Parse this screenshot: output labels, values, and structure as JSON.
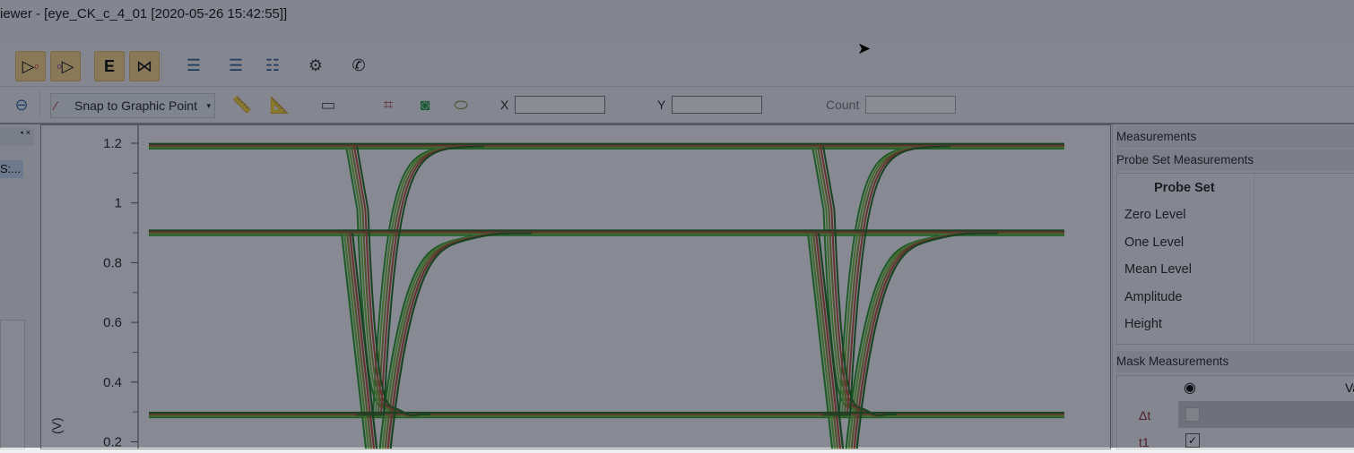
{
  "window": {
    "title": "iewer - [eye_CK_c_4_01  [2020-05-26 15:42:55]]"
  },
  "toolbar1": {
    "icons": [
      "gate-inverter-out-icon",
      "gate-inverter-in-icon",
      "edge-icon",
      "mux-icon",
      "layout-1-icon",
      "layout-2-icon",
      "layout-3-icon",
      "gear-icon",
      "phone-icon"
    ]
  },
  "toolbar2": {
    "snap_label": "Snap to Graphic Point",
    "x_label": "X",
    "x_value": "",
    "y_label": "Y",
    "y_value": "",
    "count_label": "Count",
    "count_value": ""
  },
  "left_panel": {
    "item": "S:..."
  },
  "chart_data": {
    "type": "line",
    "title": "",
    "ylabel": "(V)",
    "ylim": [
      0.15,
      1.22
    ],
    "yticks": [
      "1.2",
      "1",
      "0.8",
      "0.6",
      "0.4",
      "0.2"
    ],
    "ytick_values": [
      1.2,
      1.0,
      0.8,
      0.6,
      0.4,
      0.2
    ],
    "levels": [
      1.19,
      0.9,
      0.29
    ],
    "grid": false,
    "series_colors": [
      "#2a9a2a",
      "#6fbf3a",
      "#8a8a30",
      "#b84a3a",
      "#1d6a1d"
    ]
  },
  "measurements": {
    "title": "Measurements",
    "probe_section": "Probe Set Measurements",
    "probe_header": "Probe Set",
    "rows": [
      "Zero Level",
      "One Level",
      "Mean Level",
      "Amplitude",
      "Height"
    ],
    "mask_section": "Mask Measurements",
    "mask_col": "Va",
    "mask_rows": [
      {
        "label": "Δt",
        "checked": false
      },
      {
        "label": "t1",
        "checked": true
      }
    ]
  }
}
